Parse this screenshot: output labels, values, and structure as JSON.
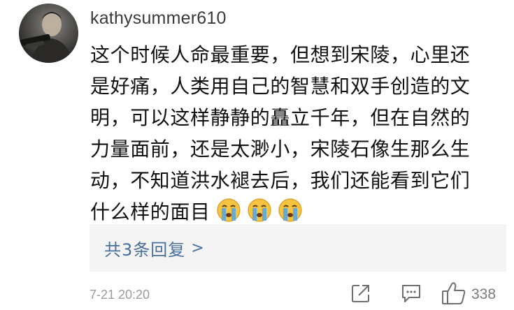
{
  "comment": {
    "username": "kathysummer610",
    "lines": [
      "这个时候人命最重要，但想到宋陵，心里还",
      "是好痛，人类用自己的智慧和双手创造的文",
      "明，可以这样静静的矗立千年，但在自然的",
      "力量面前，还是太渺小，宋陵石像生那么生",
      "动，不知道洪水褪去后，我们还能看到它们",
      "什么样的面目"
    ],
    "emojis": [
      "crying-face-icon",
      "crying-face-icon",
      "crying-face-icon"
    ],
    "replies_label": "共3条回复",
    "timestamp": "7-21 20:20",
    "like_count": "338"
  },
  "colors": {
    "link": "#4a6e9e",
    "reply_bg": "#f4f4f4",
    "meta_text": "#9b9b9b",
    "emoji_face": "#f5c443",
    "emoji_tears": "#5aa7e6"
  }
}
